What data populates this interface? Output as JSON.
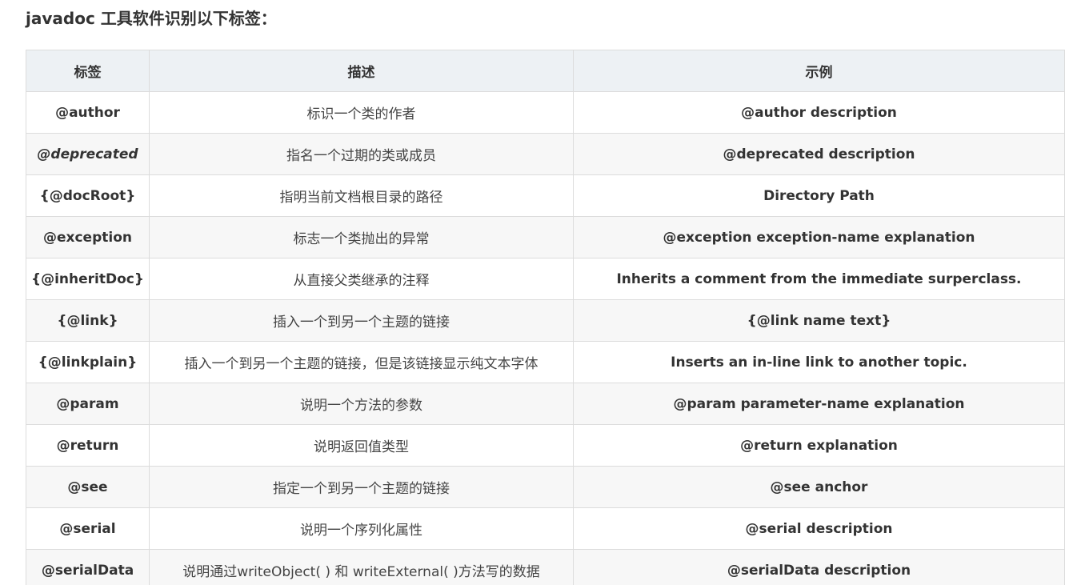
{
  "heading": "javadoc 工具软件识别以下标签：",
  "table": {
    "headers": [
      "标签",
      "描述",
      "示例"
    ],
    "rows": [
      {
        "tag": "@author",
        "description": "标识一个类的作者",
        "example": "@author description"
      },
      {
        "tag": "@deprecated",
        "description": "指名一个过期的类或成员",
        "example": "@deprecated description"
      },
      {
        "tag": "{@docRoot}",
        "description": "指明当前文档根目录的路径",
        "example": "Directory Path"
      },
      {
        "tag": "@exception",
        "description": "标志一个类抛出的异常",
        "example": "@exception exception-name explanation"
      },
      {
        "tag": "{@inheritDoc}",
        "description": "从直接父类继承的注释",
        "example": "Inherits a comment from the immediate surperclass."
      },
      {
        "tag": "{@link}",
        "description": "插入一个到另一个主题的链接",
        "example": "{@link name text}"
      },
      {
        "tag": "{@linkplain}",
        "description": "插入一个到另一个主题的链接，但是该链接显示纯文本字体",
        "example": "Inserts an in-line link to another topic."
      },
      {
        "tag": "@param",
        "description": "说明一个方法的参数",
        "example": "@param parameter-name explanation"
      },
      {
        "tag": "@return",
        "description": "说明返回值类型",
        "example": "@return explanation"
      },
      {
        "tag": "@see",
        "description": "指定一个到另一个主题的链接",
        "example": "@see anchor"
      },
      {
        "tag": "@serial",
        "description": "说明一个序列化属性",
        "example": "@serial description"
      },
      {
        "tag": "@serialData",
        "description": "说明通过writeObject( ) 和 writeExternal( )方法写的数据",
        "example": "@serialData description"
      }
    ]
  }
}
